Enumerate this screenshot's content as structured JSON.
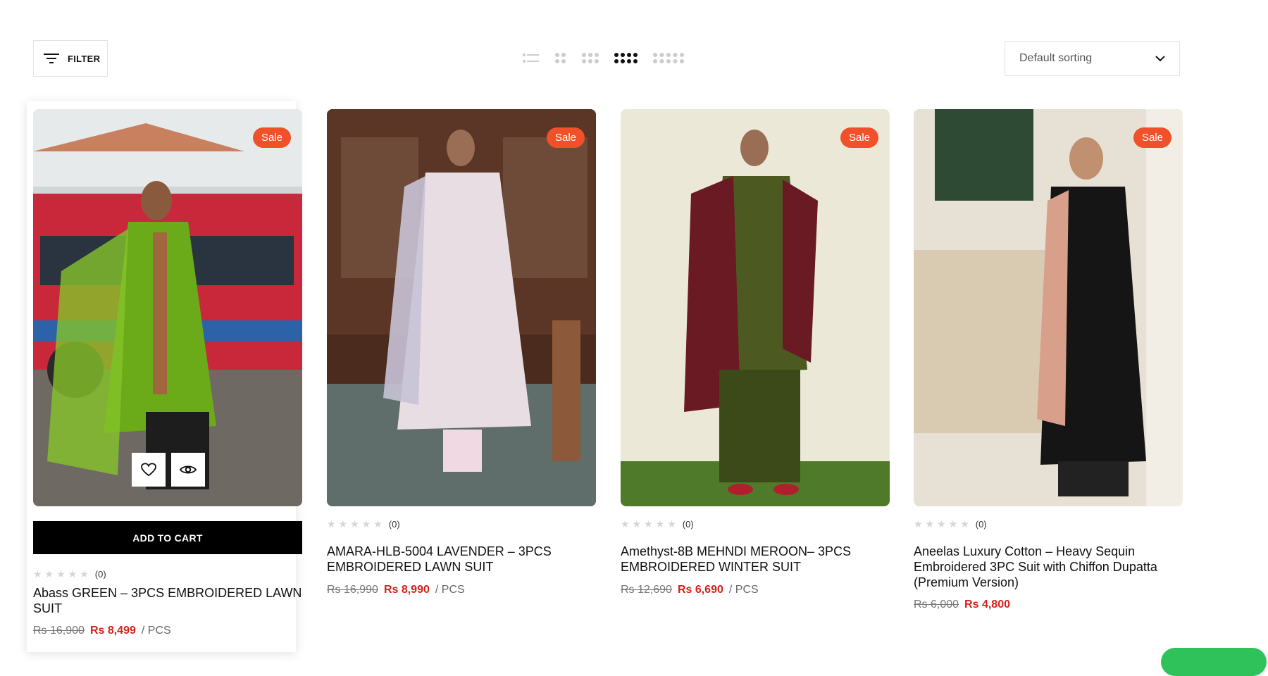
{
  "toolbar": {
    "filter_label": "FILTER",
    "sort_value": "Default sorting",
    "view_icons": [
      "list-view-icon",
      "grid-2-icon",
      "grid-3-icon",
      "grid-4-icon",
      "grid-5-icon"
    ]
  },
  "products": [
    {
      "sale_label": "Sale",
      "rating_count": "(0)",
      "title": "Abass GREEN – 3PCS EMBROIDERED LAWN SUIT",
      "old_price": "Rs 16,900",
      "new_price": "Rs 8,499",
      "unit": "/ PCS",
      "add_to_cart": "ADD TO CART"
    },
    {
      "sale_label": "Sale",
      "rating_count": "(0)",
      "title": "AMARA-HLB-5004 LAVENDER – 3PCS EMBROIDERED LAWN SUIT",
      "old_price": "Rs 16,990",
      "new_price": "Rs 8,990",
      "unit": "/ PCS"
    },
    {
      "sale_label": "Sale",
      "rating_count": "(0)",
      "title": "Amethyst-8B MEHNDI MEROON– 3PCS EMBROIDERED WINTER SUIT",
      "old_price": "Rs 12,690",
      "new_price": "Rs 6,690",
      "unit": "/ PCS"
    },
    {
      "sale_label": "Sale",
      "rating_count": "(0)",
      "title": "Aneelas Luxury Cotton – Heavy Sequin Embroidered 3PC Suit with Chiffon Dupatta (Premium Version)",
      "old_price": "Rs 6,000",
      "new_price": "Rs 4,800",
      "unit": ""
    }
  ],
  "colors": {
    "sale_badge": "#f0512b",
    "price_new": "#d8201c",
    "button_bg": "#000000"
  }
}
